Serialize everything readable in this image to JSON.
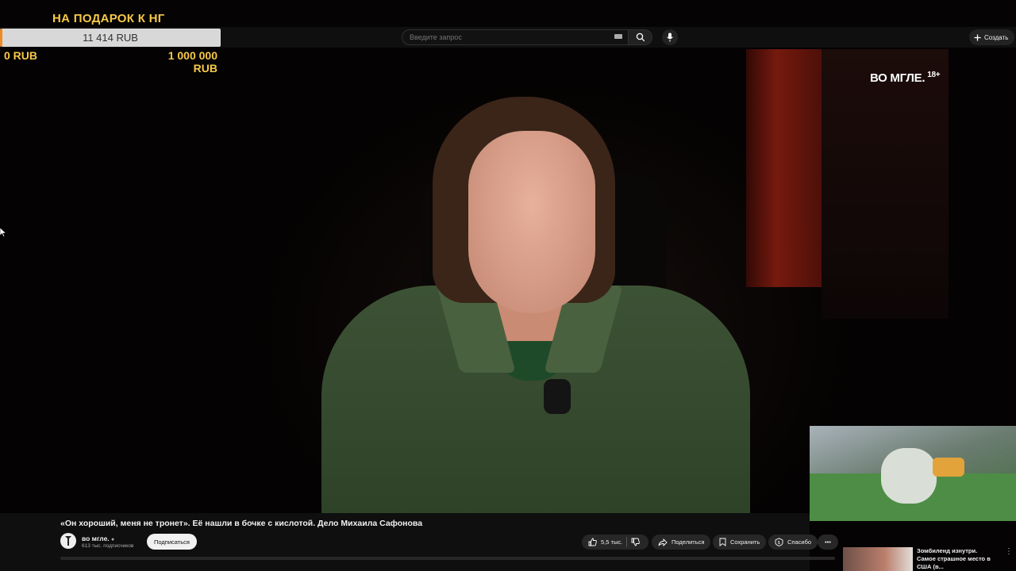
{
  "donation": {
    "title": "НА ПОДАРОК К НГ",
    "current": "11 414 RUB",
    "min": "0 RUB",
    "max": "1 000 000 RUB",
    "progress_fraction": 0.011414,
    "fill_color": "#f08a24",
    "text_color": "#f7c948"
  },
  "topbar": {
    "search_placeholder": "Введите запрос",
    "create_label": "Создать",
    "icons": [
      "keyboard-icon",
      "search-icon",
      "mic-icon",
      "plus-icon"
    ]
  },
  "video": {
    "brand": "ВО МГЛЕ.",
    "rating": "18+",
    "title": "«Он хороший, меня не тронет». Её нашли в бочке с кислотой. Дело Михаила Сафонова"
  },
  "channel": {
    "name": "во мгле.",
    "subscribers": "613 тыс. подписчиков",
    "subscribe_label": "Подписаться"
  },
  "actions": {
    "likes": "5,5 тыс.",
    "share": "Поделиться",
    "save": "Сохранить",
    "thanks": "Спасибо",
    "more": "•••"
  },
  "recommendation": {
    "title": "Зомбиленд изнутри. Самое страшное место в США (в..."
  }
}
